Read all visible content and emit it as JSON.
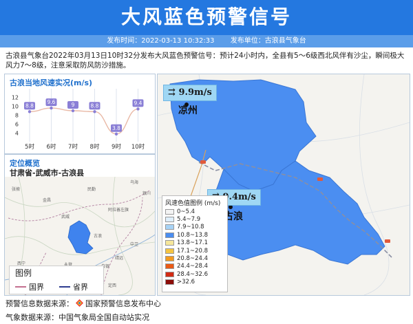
{
  "header": {
    "title": "大风蓝色预警信号"
  },
  "subbar": {
    "time_label": "发布时间：2022-03-13 10:32:33",
    "unit_label": "发布单位：古浪县气象台"
  },
  "description": "古浪县气象台2022年03月13日10时32分发布大风蓝色预警信号：预计24小时内，全县有5～6级西北风伴有沙尘，瞬间极大风力7～8级，注意采取防风防沙措施。",
  "wind_panel": {
    "title": "古浪当地风速实况(m/s)"
  },
  "location_panel": {
    "title": "定位概览",
    "location": "甘肃省-武威市-古浪县"
  },
  "chart_data": {
    "type": "line",
    "title": "古浪当地风速实况(m/s)",
    "categories": [
      "5时",
      "6时",
      "7时",
      "8时",
      "9时",
      "10时"
    ],
    "values": [
      8.8,
      9.6,
      9,
      8.8,
      3.8,
      9.4
    ],
    "data_labels": [
      "8.8",
      "9.6",
      "9",
      "8.8",
      "3.8",
      "9.4"
    ],
    "yticks": [
      "12",
      "10",
      "8",
      "6",
      "4"
    ],
    "ylim": [
      3,
      13
    ],
    "grid": false,
    "colors": {
      "line": "#e9b9a6",
      "point": "#8a7fd6",
      "label_bg": "#8a7fd6",
      "vline": "#dde3ee"
    }
  },
  "overview_map": {
    "legend_title": "图例",
    "legend_items": [
      "国界",
      "省界"
    ],
    "places": [
      "民勤",
      "武威",
      "古浪",
      "永登",
      "西宁",
      "兰州",
      "临夏",
      "定西",
      "靖远",
      "白银",
      "中卫",
      "银川",
      "乌海",
      "阿拉善左旗",
      "金昌",
      "张掖"
    ]
  },
  "main_map": {
    "wind_callouts": [
      {
        "value": "9.9m/s",
        "city": "凉州"
      },
      {
        "value": "9.4m/s",
        "city": "古浪"
      }
    ],
    "legend_title": "风速色值图例 (m/s)",
    "legend": [
      {
        "label": "0~5.4",
        "color": "#f4f4f4"
      },
      {
        "label": "5.4~7.9",
        "color": "#dfeffb"
      },
      {
        "label": "7.9~10.8",
        "color": "#a7d3f6"
      },
      {
        "label": "10.8~13.8",
        "color": "#4a8df0"
      },
      {
        "label": "13.8~17.1",
        "color": "#f6e79b"
      },
      {
        "label": "17.1~20.8",
        "color": "#f5c542"
      },
      {
        "label": "20.8~24.4",
        "color": "#f39a1f"
      },
      {
        "label": "24.4~28.4",
        "color": "#ea5a16"
      },
      {
        "label": "28.4~32.6",
        "color": "#d22b14"
      },
      {
        "label": ">32.6",
        "color": "#8c0d08"
      }
    ],
    "region_color": "#4b8ef1"
  },
  "footer": {
    "line1_prefix": "预警信息数据来源：",
    "line1_source": "国家预警信息发布中心",
    "line2": "气象数据来源：中国气象局全国自动站实况"
  }
}
